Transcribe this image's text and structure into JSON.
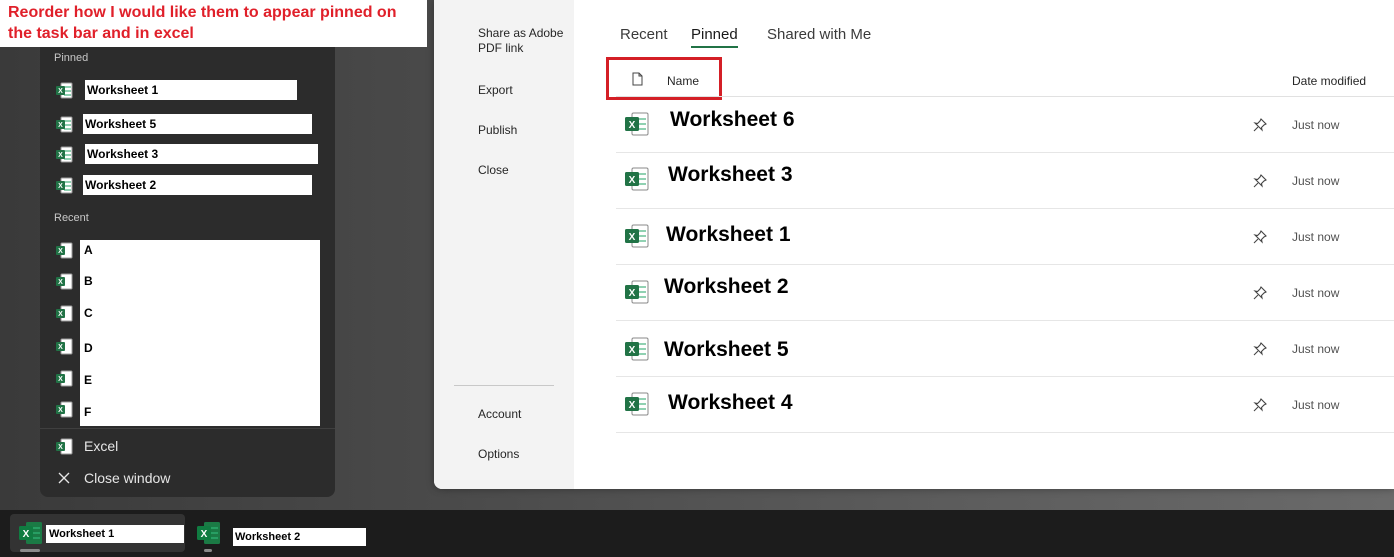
{
  "annotation": {
    "text": "Reorder how I would like them to appear pinned on the task bar and in excel"
  },
  "jumplist": {
    "pinned_header": "Pinned",
    "pinned": [
      "Worksheet 1",
      "Worksheet 5",
      "Worksheet 3",
      "Worksheet 2"
    ],
    "recent_header": "Recent",
    "recent": [
      "A",
      "B",
      "C",
      "D",
      "E",
      "F"
    ],
    "app_label": "Excel",
    "close_label": "Close window"
  },
  "backstage": {
    "nav": {
      "share_adobe": "Share as Adobe PDF link",
      "export": "Export",
      "publish": "Publish",
      "close": "Close",
      "account": "Account",
      "options": "Options"
    },
    "tabs": [
      "Recent",
      "Pinned",
      "Shared with Me"
    ],
    "active_tab": "Pinned",
    "columns": {
      "name": "Name",
      "date": "Date modified"
    },
    "files": [
      {
        "name": "Worksheet 6",
        "date": "Just now"
      },
      {
        "name": "Worksheet 3",
        "date": "Just now"
      },
      {
        "name": "Worksheet 1",
        "date": "Just now"
      },
      {
        "name": "Worksheet 2",
        "date": "Just now"
      },
      {
        "name": "Worksheet 5",
        "date": "Just now"
      },
      {
        "name": "Worksheet 4",
        "date": "Just now"
      }
    ]
  },
  "taskbar": {
    "apps": [
      {
        "label": "Worksheet 1"
      },
      {
        "label": "Worksheet 2"
      }
    ]
  },
  "colors": {
    "excel_green": "#217346",
    "annotation_red": "#e0202a",
    "highlight_box": "#d41f26"
  },
  "icons": {
    "excel": "excel-icon",
    "pin": "pin-icon",
    "file": "file-icon",
    "close": "close-icon"
  }
}
